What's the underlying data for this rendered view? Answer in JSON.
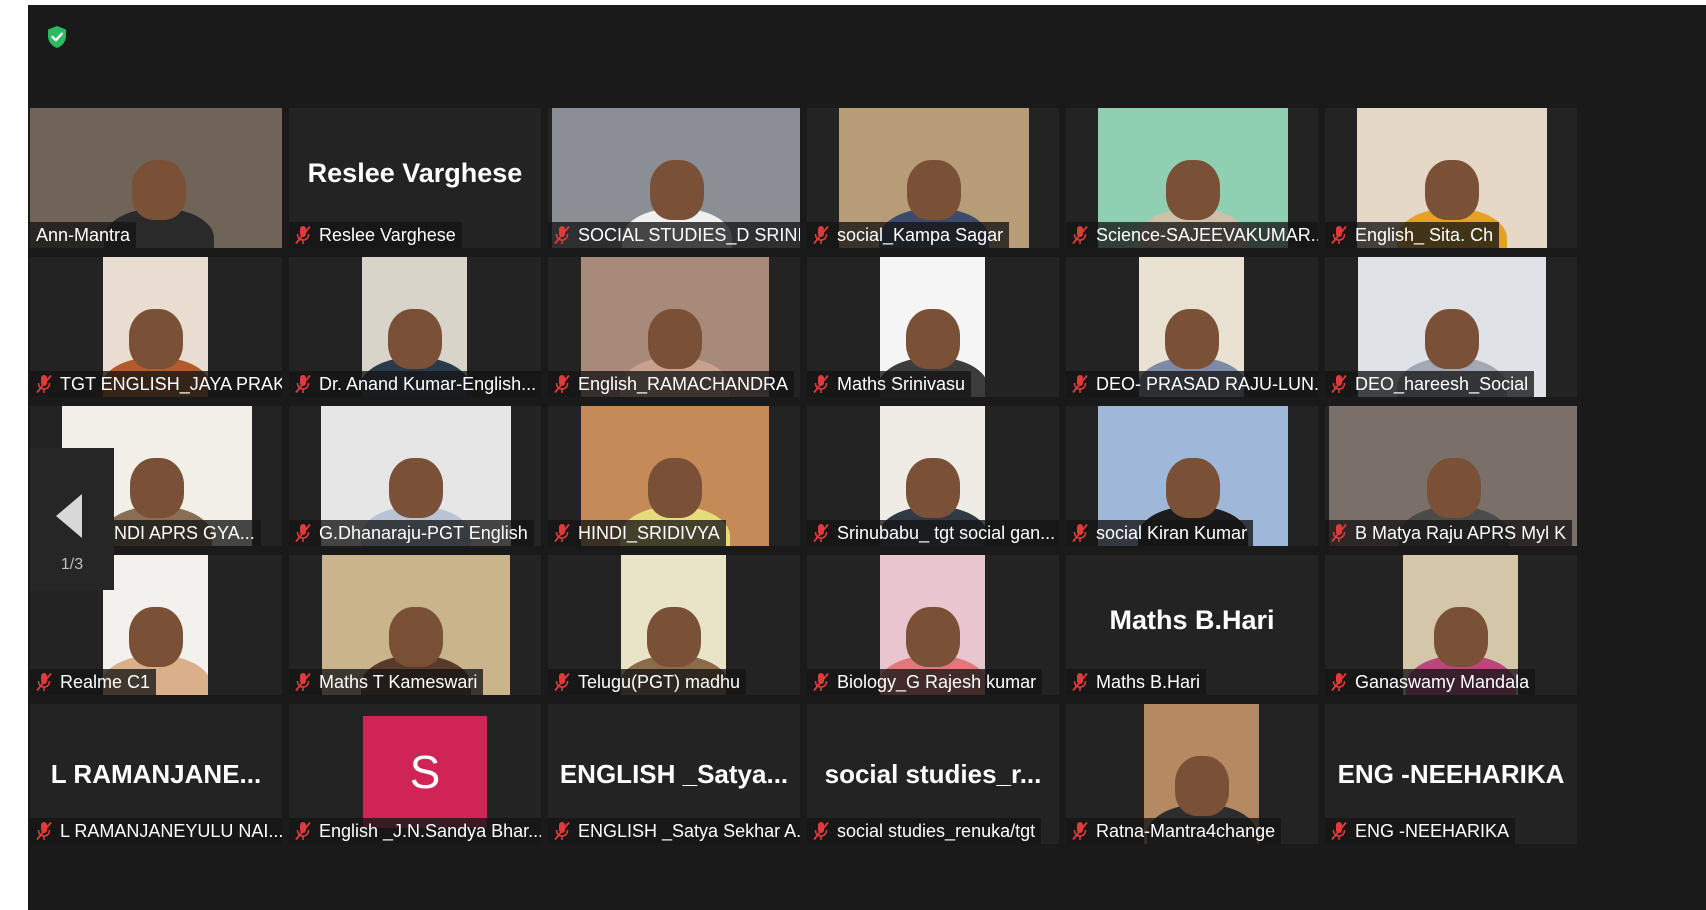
{
  "window": {
    "security_icon": "shield-check-icon",
    "accent": "#2bbb5f",
    "active_speaker_border": "#c8df5c"
  },
  "pager": {
    "label": "1/3",
    "icon": "chevron-left-icon"
  },
  "participants": [
    {
      "name": "Ann-Mantra",
      "muted": false,
      "display": "video",
      "active": true
    },
    {
      "name": "Reslee Varghese",
      "muted": true,
      "display": "name",
      "big_label": "Reslee Varghese"
    },
    {
      "name": "SOCIAL STUDIES_D SRINI...",
      "muted": true,
      "display": "video"
    },
    {
      "name": "social_Kampa Sagar",
      "muted": true,
      "display": "video"
    },
    {
      "name": "Science-SAJEEVAKUMAR....",
      "muted": true,
      "display": "video"
    },
    {
      "name": "English_ Sita. Ch",
      "muted": true,
      "display": "video"
    },
    {
      "name": "TGT ENGLISH_JAYA PRAK...",
      "muted": true,
      "display": "video"
    },
    {
      "name": "Dr. Anand Kumar-English...",
      "muted": true,
      "display": "video"
    },
    {
      "name": "English_RAMACHANDRA",
      "muted": true,
      "display": "video"
    },
    {
      "name": "Maths Srinivasu",
      "muted": true,
      "display": "video"
    },
    {
      "name": "DEO- PRASAD RAJU-LUN...",
      "muted": true,
      "display": "video"
    },
    {
      "name": "DEO_hareesh_Social",
      "muted": true,
      "display": "video"
    },
    {
      "name": "AR BANDI APRS GYA...",
      "muted": true,
      "display": "video"
    },
    {
      "name": "G.Dhanaraju-PGT English",
      "muted": true,
      "display": "video"
    },
    {
      "name": "HINDI_SRIDIVYA",
      "muted": true,
      "display": "video"
    },
    {
      "name": "Srinubabu_ tgt social gan...",
      "muted": true,
      "display": "video"
    },
    {
      "name": "social Kiran Kumar",
      "muted": true,
      "display": "video"
    },
    {
      "name": "B Matya Raju APRS Myl K",
      "muted": true,
      "display": "video"
    },
    {
      "name": "Realme C1",
      "muted": true,
      "display": "video"
    },
    {
      "name": "Maths T Kameswari",
      "muted": true,
      "display": "video"
    },
    {
      "name": "Telugu(PGT) madhu",
      "muted": true,
      "display": "video"
    },
    {
      "name": "Biology_G Rajesh kumar",
      "muted": true,
      "display": "video"
    },
    {
      "name": "Maths  B.Hari",
      "muted": true,
      "display": "name",
      "big_label": "Maths  B.Hari"
    },
    {
      "name": "Ganaswamy Mandala",
      "muted": true,
      "display": "video"
    },
    {
      "name": "L RAMANJANEYULU NAI...",
      "muted": true,
      "display": "name",
      "big_label": "L  RAMANJANE..."
    },
    {
      "name": "English _J.N.Sandya Bhar...",
      "muted": true,
      "display": "avatar",
      "avatar_letter": "S",
      "avatar_color": "#d02457"
    },
    {
      "name": "ENGLISH _Satya Sekhar A...",
      "muted": true,
      "display": "name",
      "big_label": "ENGLISH  _Satya..."
    },
    {
      "name": "social studies_renuka/tgt",
      "muted": true,
      "display": "name",
      "big_label": "social  studies_r..."
    },
    {
      "name": "Ratna-Mantra4change",
      "muted": true,
      "display": "video"
    },
    {
      "name": "ENG -NEEHARIKA",
      "muted": true,
      "display": "name",
      "big_label": "ENG -NEEHARIKA"
    }
  ]
}
